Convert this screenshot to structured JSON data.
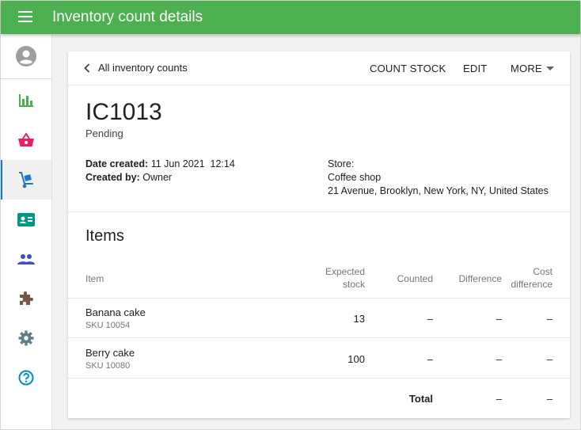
{
  "app": {
    "title": "Inventory count details"
  },
  "colors": {
    "appbar": "#4caf50",
    "active_indicator": "#1976d2"
  },
  "sidebar": {
    "items": [
      {
        "name": "account",
        "icon": "account-circle-icon",
        "color": "#9e9e9e"
      },
      {
        "name": "reports",
        "icon": "bar-chart-icon",
        "color": "#4caf50"
      },
      {
        "name": "sales",
        "icon": "basket-icon",
        "color": "#e91e63"
      },
      {
        "name": "inventory",
        "icon": "hand-truck-icon",
        "color": "#1976d2",
        "active": true
      },
      {
        "name": "employees",
        "icon": "id-card-icon",
        "color": "#009688"
      },
      {
        "name": "customers",
        "icon": "people-icon",
        "color": "#3f51b5"
      },
      {
        "name": "integrations",
        "icon": "puzzle-icon",
        "color": "#795548"
      },
      {
        "name": "settings",
        "icon": "gear-icon",
        "color": "#607d8b"
      },
      {
        "name": "help",
        "icon": "help-icon",
        "color": "#0288d1"
      }
    ]
  },
  "toolbar": {
    "back_label": "All inventory counts",
    "count_stock_label": "COUNT STOCK",
    "edit_label": "EDIT",
    "more_label": "MORE"
  },
  "count": {
    "id": "IC1013",
    "status": "Pending",
    "date_created_label": "Date created:",
    "date_created_value": "11 Jun 2021  12:14",
    "created_by_label": "Created by:",
    "created_by_value": "Owner",
    "store_label": "Store:",
    "store_name": "Coffee shop",
    "store_address": "21 Avenue, Brooklyn, New York, NY, United States"
  },
  "items_section": {
    "title": "Items",
    "columns": {
      "item": "Item",
      "expected_line1": "Expected",
      "expected_line2": "stock",
      "counted": "Counted",
      "difference": "Difference",
      "cost_line1": "Cost",
      "cost_line2": "difference"
    },
    "rows": [
      {
        "name": "Banana cake",
        "sku": "SKU 10054",
        "expected": "13",
        "counted": "–",
        "difference": "–",
        "cost_difference": "–"
      },
      {
        "name": "Berry cake",
        "sku": "SKU 10080",
        "expected": "100",
        "counted": "–",
        "difference": "–",
        "cost_difference": "–"
      }
    ],
    "total": {
      "label": "Total",
      "difference": "–",
      "cost_difference": "–"
    }
  }
}
